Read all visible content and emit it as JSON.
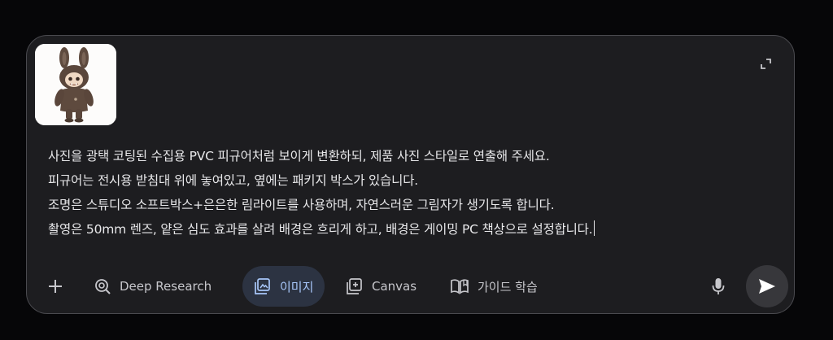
{
  "attachment": {
    "icon": "plush-toy-thumbnail"
  },
  "prompt": {
    "lines": [
      "사진을 광택 코팅된 수집용 PVC 피규어처럼 보이게 변환하되, 제품 사진 스타일로 연출해 주세요.",
      "피규어는 전시용 받침대 위에 놓여있고, 옆에는 패키지 박스가 있습니다.",
      "조명은 스튜디오 소프트박스+은은한 림라이트를 사용하며, 자연스러운 그림자가 생기도록 합니다.",
      "촬영은 50mm 렌즈, 얕은 심도 효과를 살려 배경은 흐리게 하고, 배경은 게이밍 PC 책상으로 설정합니다."
    ]
  },
  "toolbar": {
    "deep_research_label": "Deep Research",
    "image_label": "이미지",
    "canvas_label": "Canvas",
    "guide_label": "가이드 학습"
  },
  "colors": {
    "background": "#060608",
    "composer": "#1d1d20",
    "text": "#e8e8ea",
    "active_chip_bg": "#2c3342",
    "active_chip_text": "#a8c7fa"
  }
}
